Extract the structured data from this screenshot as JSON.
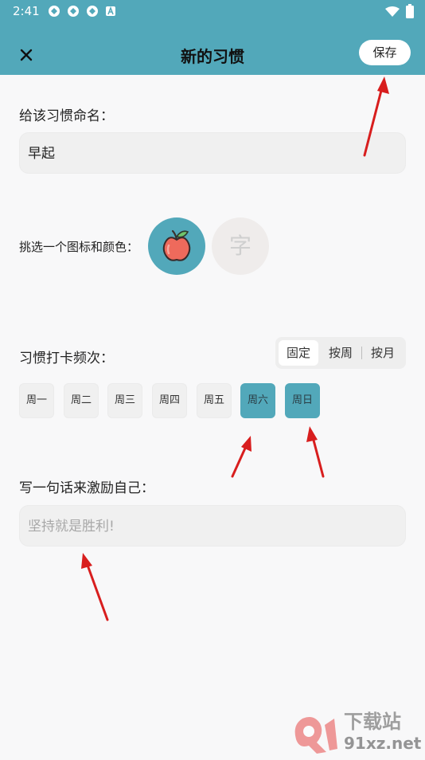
{
  "status_bar": {
    "time": "2:41",
    "icons": [
      "app-icon",
      "app-icon",
      "app-icon",
      "a-notification-icon",
      "wifi-icon",
      "battery-icon"
    ]
  },
  "header": {
    "title": "新的习惯",
    "save_label": "保存",
    "close_icon": "close-icon"
  },
  "name_section": {
    "label": "给该习惯命名：",
    "value": "早起"
  },
  "icon_section": {
    "label": "挑选一个图标和颜色：",
    "options": [
      "apple-icon",
      "字"
    ],
    "selected_color": "#52a8ba"
  },
  "frequency": {
    "label": "习惯打卡频次：",
    "modes": [
      "固定",
      "按周",
      "按月"
    ],
    "selected_mode": "固定",
    "days": [
      "周一",
      "周二",
      "周三",
      "周四",
      "周五",
      "周六",
      "周日"
    ],
    "selected_days": [
      "周六",
      "周日"
    ]
  },
  "motto": {
    "label": "写一句话来激励自己：",
    "placeholder": "坚持就是胜利!"
  },
  "watermark": {
    "brand": "下载站",
    "site": "91xz.net"
  },
  "colors": {
    "accent": "#52a8ba",
    "annotation_arrow": "#d81e1e",
    "background": "#f8f8f9"
  }
}
